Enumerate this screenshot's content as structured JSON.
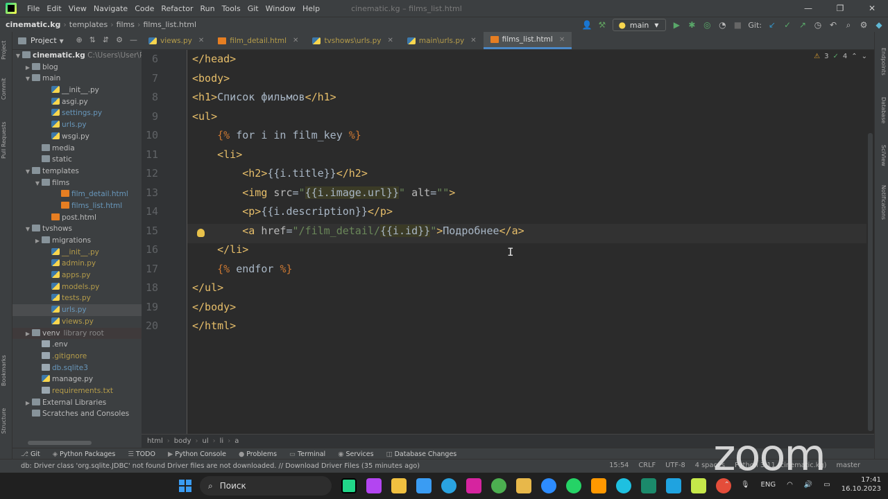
{
  "window": {
    "project": "cinematic.kg",
    "file": "films_list.html",
    "title": "cinematic.kg – films_list.html"
  },
  "menu": [
    "File",
    "Edit",
    "View",
    "Navigate",
    "Code",
    "Refactor",
    "Run",
    "Tools",
    "Git",
    "Window",
    "Help"
  ],
  "breadcrumb_nav": [
    "cinematic.kg",
    "templates",
    "films",
    "films_list.html"
  ],
  "toolbar": {
    "branch": "main",
    "git_label": "Git:"
  },
  "project_panel": {
    "title": "Project",
    "root": "cinematic.kg",
    "root_path": "C:\\Users\\User\\Pycha",
    "items": [
      {
        "label": "blog",
        "type": "folder",
        "indent": 1,
        "arrow": "▶"
      },
      {
        "label": "main",
        "type": "folder",
        "indent": 1,
        "arrow": "▼"
      },
      {
        "label": "__init__.py",
        "type": "py",
        "indent": 3
      },
      {
        "label": "asgi.py",
        "type": "py",
        "indent": 3
      },
      {
        "label": "settings.py",
        "type": "py",
        "indent": 3,
        "color": "blue"
      },
      {
        "label": "urls.py",
        "type": "py",
        "indent": 3,
        "color": "blue"
      },
      {
        "label": "wsgi.py",
        "type": "py",
        "indent": 3
      },
      {
        "label": "media",
        "type": "folder",
        "indent": 2
      },
      {
        "label": "static",
        "type": "folder",
        "indent": 2
      },
      {
        "label": "templates",
        "type": "folder",
        "indent": 1,
        "arrow": "▼"
      },
      {
        "label": "films",
        "type": "folder",
        "indent": 2,
        "arrow": "▼"
      },
      {
        "label": "film_detail.html",
        "type": "html",
        "indent": 4,
        "color": "blue"
      },
      {
        "label": "films_list.html",
        "type": "html",
        "indent": 4,
        "color": "blue"
      },
      {
        "label": "post.html",
        "type": "html",
        "indent": 3
      },
      {
        "label": "tvshows",
        "type": "folder",
        "indent": 1,
        "arrow": "▼"
      },
      {
        "label": "migrations",
        "type": "folder",
        "indent": 2,
        "arrow": "▶"
      },
      {
        "label": "__init__.py",
        "type": "py",
        "indent": 3,
        "color": "yellow"
      },
      {
        "label": "admin.py",
        "type": "py",
        "indent": 3,
        "color": "yellow"
      },
      {
        "label": "apps.py",
        "type": "py",
        "indent": 3,
        "color": "yellow"
      },
      {
        "label": "models.py",
        "type": "py",
        "indent": 3,
        "color": "yellow"
      },
      {
        "label": "tests.py",
        "type": "py",
        "indent": 3,
        "color": "yellow"
      },
      {
        "label": "urls.py",
        "type": "py",
        "indent": 3,
        "color": "blue",
        "selected": true
      },
      {
        "label": "views.py",
        "type": "py",
        "indent": 3,
        "color": "yellow"
      },
      {
        "label": "venv",
        "type": "folder",
        "indent": 1,
        "arrow": "▶",
        "suffix": "library root"
      },
      {
        "label": ".env",
        "type": "txt",
        "indent": 2
      },
      {
        "label": ".gitignore",
        "type": "txt",
        "indent": 2,
        "color": "yellow"
      },
      {
        "label": "db.sqlite3",
        "type": "txt",
        "indent": 2,
        "color": "blue"
      },
      {
        "label": "manage.py",
        "type": "py",
        "indent": 2
      },
      {
        "label": "requirements.txt",
        "type": "txt",
        "indent": 2,
        "color": "yellow"
      },
      {
        "label": "External Libraries",
        "type": "folder",
        "indent": 1,
        "arrow": "▶"
      },
      {
        "label": "Scratches and Consoles",
        "type": "folder",
        "indent": 1
      }
    ]
  },
  "tabs": [
    {
      "label": "views.py"
    },
    {
      "label": "film_detail.html"
    },
    {
      "label": "tvshows\\urls.py"
    },
    {
      "label": "main\\urls.py"
    },
    {
      "label": "films_list.html",
      "active": true
    }
  ],
  "inspections": {
    "warnings": "3",
    "ok": "4"
  },
  "code_lines": [
    {
      "n": "6",
      "html": "<span class='tg'>&lt;/head&gt;</span>"
    },
    {
      "n": "7",
      "html": "<span class='tg'>&lt;body&gt;</span>"
    },
    {
      "n": "8",
      "html": "<span class='tg'>&lt;h1&gt;</span>Список фильмов<span class='tg'>&lt;/h1&gt;</span>"
    },
    {
      "n": "9",
      "html": "<span class='tg'>&lt;ul&gt;</span>"
    },
    {
      "n": "10",
      "html": "    <span class='dj'>{%</span> for i in film_key <span class='dj'>%}</span>"
    },
    {
      "n": "11",
      "html": "    <span class='tg'>&lt;li&gt;</span>"
    },
    {
      "n": "12",
      "html": "        <span class='tg'>&lt;h2&gt;</span>{{i.title}}<span class='tg'>&lt;/h2&gt;</span>"
    },
    {
      "n": "13",
      "html": "        <span class='tg'>&lt;img </span><span class='at'>src</span>=<span class='st'>\"<span class='tm'>{{i.image.url}}</span>\"</span> <span class='at'>alt</span>=<span class='st'>\"\"</span><span class='tg'>&gt;</span>"
    },
    {
      "n": "14",
      "html": "        <span class='tg'>&lt;p&gt;</span>{{i.description}}<span class='tg'>&lt;/p&gt;</span>"
    },
    {
      "n": "15",
      "html": "        <span class='tg'>&lt;a </span><span class='at'>href</span>=<span class='st'>\"/film_detail/<span class='tm'>{{i.id}}</span>\"</span><span class='tg'>&gt;</span>Подробнее<span class='tg'>&lt;/a&gt;</span>"
    },
    {
      "n": "16",
      "html": "    <span class='tg'>&lt;/li&gt;</span>"
    },
    {
      "n": "17",
      "html": "    <span class='dj'>{%</span> endfor <span class='dj'>%}</span>"
    },
    {
      "n": "18",
      "html": "<span class='tg'>&lt;/ul&gt;</span>"
    },
    {
      "n": "19",
      "html": "<span class='tg'>&lt;/body&gt;</span>"
    },
    {
      "n": "20",
      "html": "<span class='tg'>&lt;/html&gt;</span>"
    }
  ],
  "editor_breadcrumb": [
    "html",
    "body",
    "ul",
    "li",
    "a"
  ],
  "bottom_tools": [
    "Git",
    "Python Packages",
    "TODO",
    "Python Console",
    "Problems",
    "Terminal",
    "Services",
    "Database Changes"
  ],
  "status": {
    "message": "db: Driver class 'org.sqlite.JDBC' not found Driver files are not downloaded. // Download Driver Files (35 minutes ago)",
    "position": "15:54",
    "line_sep": "CRLF",
    "encoding": "UTF-8",
    "indent": "4 spaces",
    "interpreter": "Python 3.11 (cinematic.kg)",
    "branch": "master"
  },
  "left_strip": [
    "Project",
    "Commit",
    "Pull Requests",
    "Bookmarks",
    "Structure"
  ],
  "right_strip": [
    "Endpoints",
    "Database",
    "SciView",
    "Notifications"
  ],
  "zoom_watermark": "zoom",
  "taskbar": {
    "search_placeholder": "Поиск",
    "lang": "ENG",
    "time": "17:41",
    "date": "16.10.2023"
  }
}
